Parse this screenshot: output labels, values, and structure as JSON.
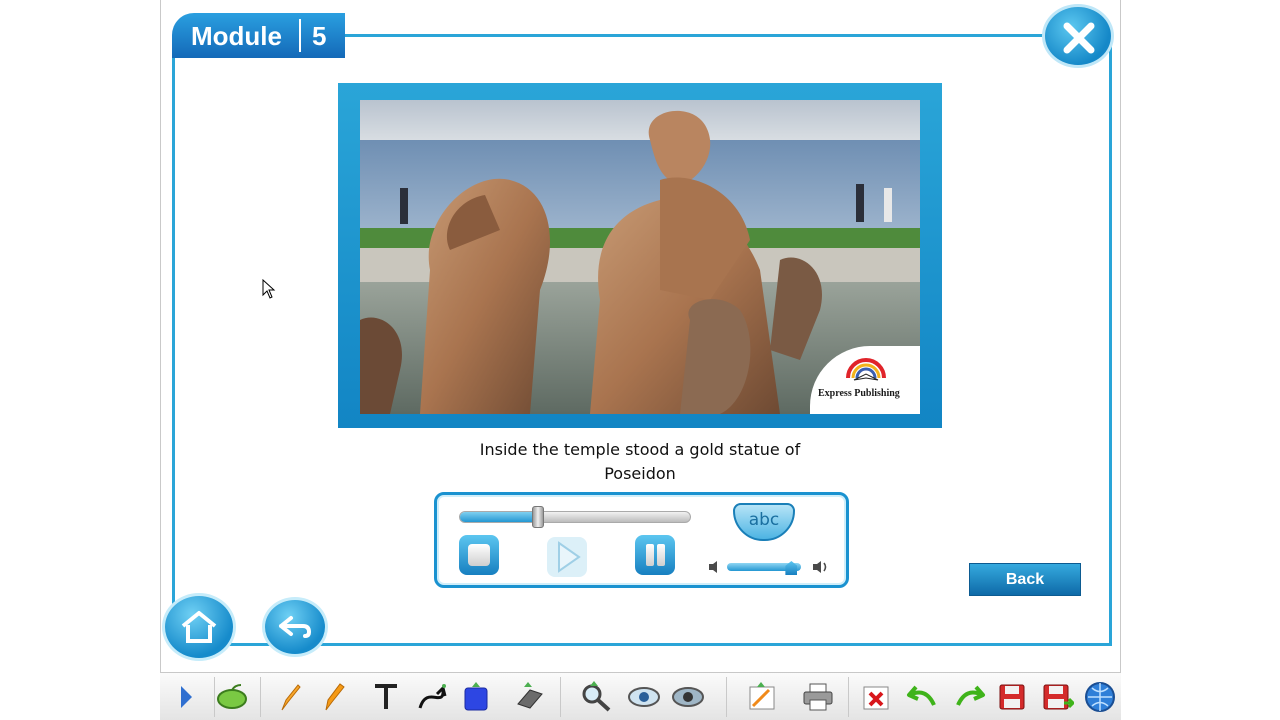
{
  "header": {
    "module_label": "Module",
    "module_number": "5"
  },
  "video": {
    "publisher_logo_text": "Express Publishing"
  },
  "caption": {
    "line1": "Inside the temple stood a gold statue of",
    "line2": "Poseidon"
  },
  "player": {
    "progress": 0.34,
    "volume": 0.87,
    "subtitles_label": "abc"
  },
  "buttons": {
    "back_label": "Back"
  },
  "toolbar": {
    "items": [
      "toggle-toolbar",
      "mouse",
      "pencil",
      "highlighter",
      "text",
      "curve",
      "shape",
      "eraser",
      "zoom",
      "spotlight",
      "reveal",
      "notes",
      "print",
      "clear",
      "undo",
      "redo",
      "save",
      "save-as",
      "web"
    ]
  },
  "colors": {
    "accent": "#1a92d0",
    "accent_dark": "#1469b8",
    "frame": "#2aa5d8"
  }
}
